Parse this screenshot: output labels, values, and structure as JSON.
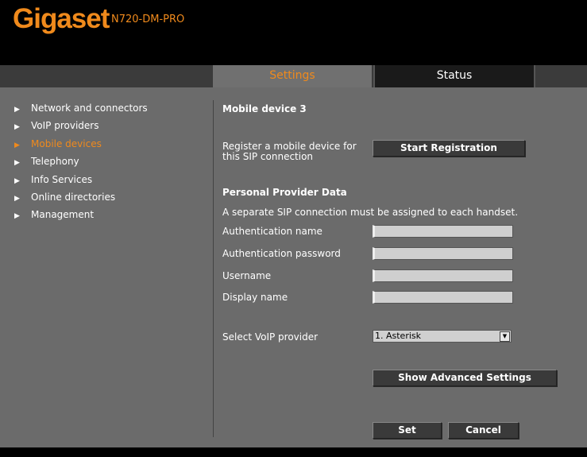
{
  "header": {
    "brand": "Gigaset",
    "model": "N720-DM-PRO"
  },
  "tabs": {
    "settings": "Settings",
    "status": "Status"
  },
  "sidebar": {
    "items": [
      {
        "label": "Network and connectors",
        "active": false
      },
      {
        "label": "VoIP providers",
        "active": false
      },
      {
        "label": "Mobile devices",
        "active": true
      },
      {
        "label": "Telephony",
        "active": false
      },
      {
        "label": "Info Services",
        "active": false
      },
      {
        "label": "Online directories",
        "active": false
      },
      {
        "label": "Management",
        "active": false
      }
    ],
    "arrow_icon": "triangle-right-icon"
  },
  "main": {
    "title": "Mobile device 3",
    "register_label_line1": "Register a mobile device for",
    "register_label_line2": "this SIP connection",
    "start_registration_button": "Start Registration",
    "section_title": "Personal Provider Data",
    "note": "A separate SIP connection must be assigned to each handset.",
    "fields": {
      "auth_name": {
        "label": "Authentication name",
        "value": ""
      },
      "auth_password": {
        "label": "Authentication password",
        "value": ""
      },
      "username": {
        "label": "Username",
        "value": ""
      },
      "display_name": {
        "label": "Display name",
        "value": ""
      }
    },
    "voip_provider_label": "Select VoIP provider",
    "voip_provider_selected": "1. Asterisk",
    "advanced_button": "Show Advanced Settings",
    "set_button": "Set",
    "cancel_button": "Cancel"
  },
  "colors": {
    "accent": "#f08a1c",
    "panel": "#6b6b6b",
    "background": "#000000"
  }
}
